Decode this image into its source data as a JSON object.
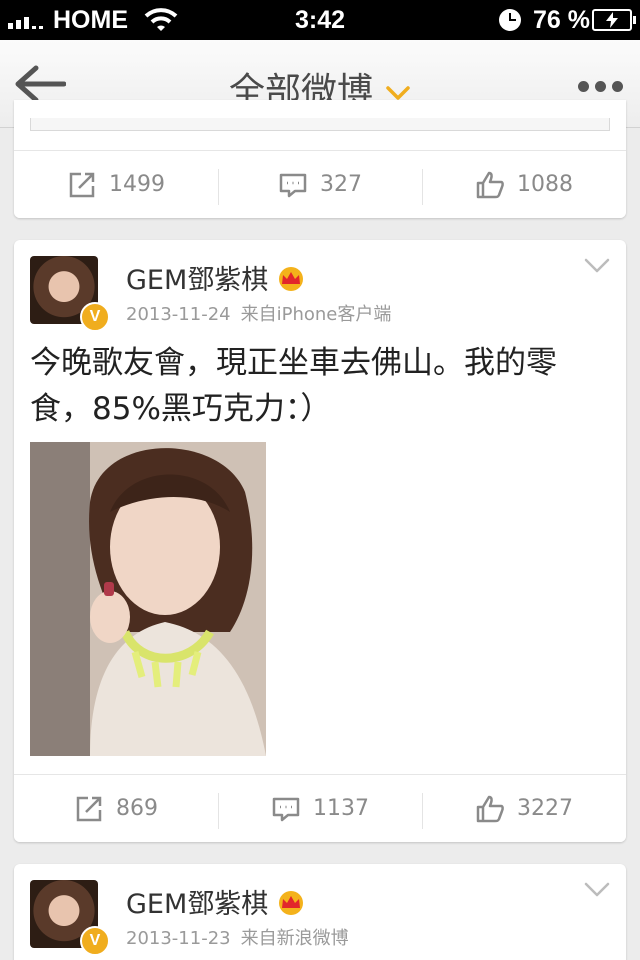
{
  "status_bar": {
    "carrier": "HOME",
    "time": "3:42",
    "battery_percent": "76 %"
  },
  "nav": {
    "title": "全部微博",
    "accent_color": "#f0ad1e"
  },
  "top_card": {
    "reposts": "1499",
    "comments": "327",
    "likes": "1088"
  },
  "posts": [
    {
      "username": "GEM鄧紫棋",
      "date": "2013-11-24",
      "source": "来自iPhone客户端",
      "text": "今晚歌友會，現正坐車去佛山。我的零食，85%黑巧克力：）",
      "reposts": "869",
      "comments": "1137",
      "likes": "3227"
    },
    {
      "username": "GEM鄧紫棋",
      "date": "2013-11-23",
      "source": "来自新浪微博"
    }
  ]
}
